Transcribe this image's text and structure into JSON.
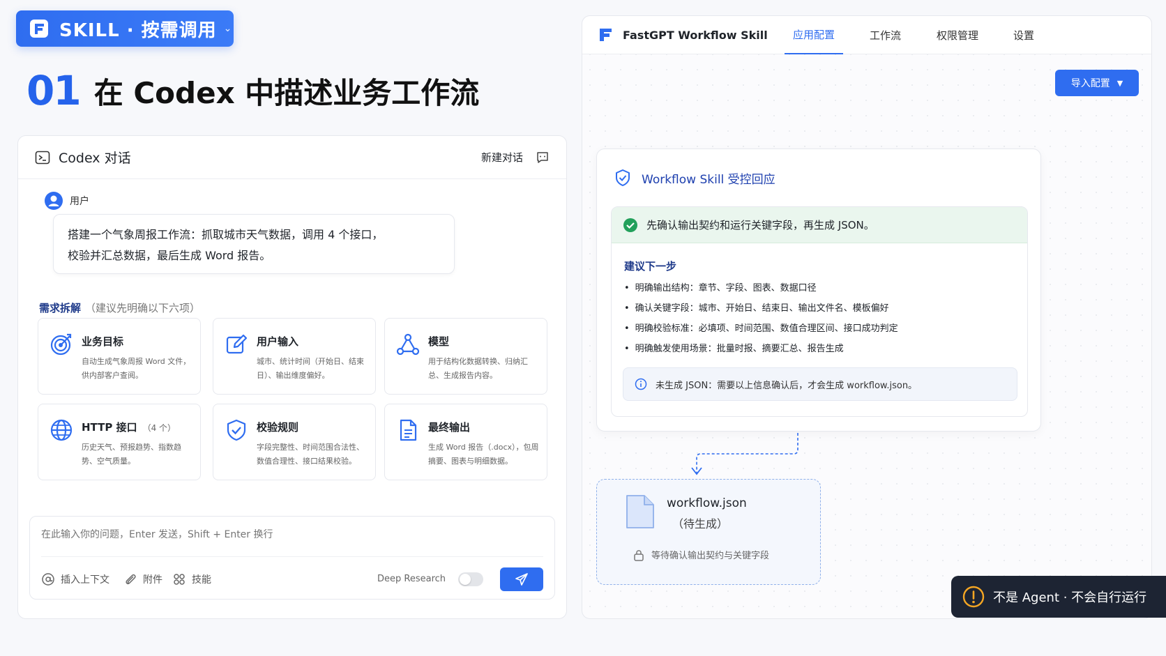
{
  "badge": {
    "label": "SKILL · 按需调用"
  },
  "step": {
    "number": "01",
    "title": "在 Codex 中描述业务工作流"
  },
  "codex": {
    "title": "Codex 对话",
    "new_chat": "新建对话",
    "user_label": "用户",
    "user_message_line1": "搭建一个气象周报工作流：抓取城市天气数据，调用 4 个接口，",
    "user_message_line2": "校验并汇总数据，最后生成 Word 报告。",
    "requirements_title": "需求拆解",
    "requirements_hint": "（建议先明确以下六项）",
    "cards": [
      {
        "title": "业务目标",
        "count": "",
        "desc": "自动生成气象周报 Word 文件，供内部客户查阅。",
        "icon": "target-icon"
      },
      {
        "title": "用户输入",
        "count": "",
        "desc": "城市、统计时间（开始日、结束日）、输出维度偏好。",
        "icon": "edit-icon"
      },
      {
        "title": "模型",
        "count": "",
        "desc": "用于结构化数据转换、归纳汇总、生成报告内容。",
        "icon": "model-icon"
      },
      {
        "title": "HTTP 接口",
        "count": "（4 个）",
        "desc": "历史天气、预报趋势、指数趋势、空气质量。",
        "icon": "globe-icon"
      },
      {
        "title": "校验规则",
        "count": "",
        "desc": "字段完整性、时间范围合法性、数值合理性、接口结果校验。",
        "icon": "shield-check-icon"
      },
      {
        "title": "最终输出",
        "count": "",
        "desc": "生成 Word 报告（.docx），包周摘要、图表与明细数据。",
        "icon": "document-icon"
      }
    ],
    "input_placeholder": "在此输入你的问题，Enter 发送，Shift + Enter 换行",
    "tools": {
      "context": "插入上下文",
      "attach": "附件",
      "skills": "技能"
    },
    "deep_research": "Deep Research"
  },
  "fastgpt": {
    "app_name": "FastGPT Workflow Skill",
    "tabs": [
      "应用配置",
      "工作流",
      "权限管理",
      "设置"
    ],
    "active_tab": "应用配置",
    "import_button": "导入配置",
    "response": {
      "title": "Workflow Skill 受控回应",
      "confirm": "先确认输出契约和运行关键字段，再生成 JSON。",
      "next_title": "建议下一步",
      "bullets": [
        "明确输出结构：章节、字段、图表、数据口径",
        "确认关键字段：城市、开始日、结束日、输出文件名、模板偏好",
        "明确校验标准：必填项、时间范围、数值合理区间、接口成功判定",
        "明确触发使用场景：批量时报、摘要汇总、报告生成"
      ],
      "info": "未生成 JSON：需要以上信息确认后，才会生成 workflow.json。"
    },
    "json_file": {
      "name": "workflow.json",
      "state": "（待生成）",
      "wait": "等待确认输出契约与关键字段"
    }
  },
  "warning": {
    "text": "不是 Agent · 不会自行运行"
  },
  "colors": {
    "accent": "#2f6df0",
    "success": "#22a05b",
    "dark": "#1d2433",
    "warning": "#f5a623"
  }
}
